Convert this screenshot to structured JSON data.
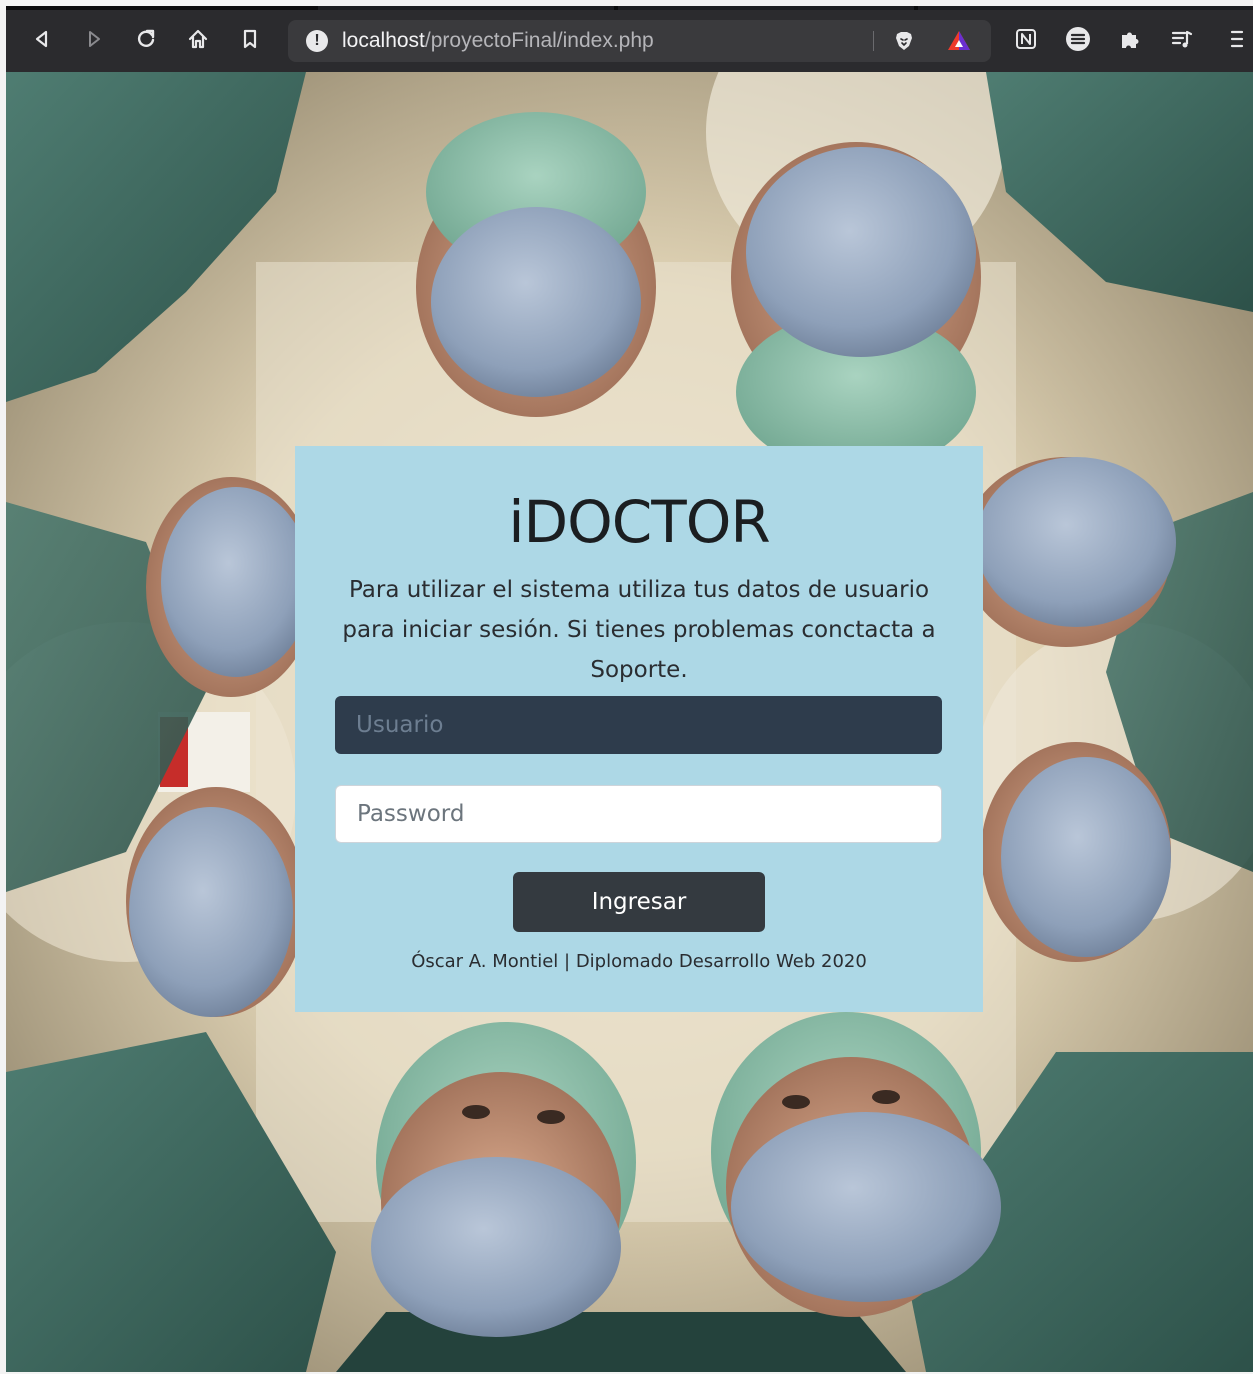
{
  "browser": {
    "url_host": "localhost",
    "url_path": "/proyectoFinal/index.php",
    "icons": {
      "back": "back-arrow-icon",
      "forward": "forward-arrow-icon",
      "reload": "reload-icon",
      "home": "home-icon",
      "bookmark": "bookmark-icon",
      "site_info": "info-icon",
      "brave_shields": "brave-lion-icon",
      "brave_rewards": "brave-rewards-triangle-icon",
      "notion": "notion-icon",
      "list_ext": "list-circle-icon",
      "extensions": "puzzle-icon",
      "playlist": "playlist-icon",
      "menu": "menu-icon"
    }
  },
  "login": {
    "title": "iDOCTOR",
    "description": "Para utilizar el sistema utiliza tus datos de usuario para iniciar sesión. Si tienes problemas conctacta a Soporte.",
    "username_placeholder": "Usuario",
    "password_placeholder": "Password",
    "submit_label": "Ingresar",
    "footer": "Óscar A. Montiel | Diplomado Desarrollo Web 2020"
  },
  "colors": {
    "card_background": "#add8e6",
    "username_field": "#2e3c4c",
    "button": "#343a40",
    "toolbar": "#2b2b2e"
  }
}
